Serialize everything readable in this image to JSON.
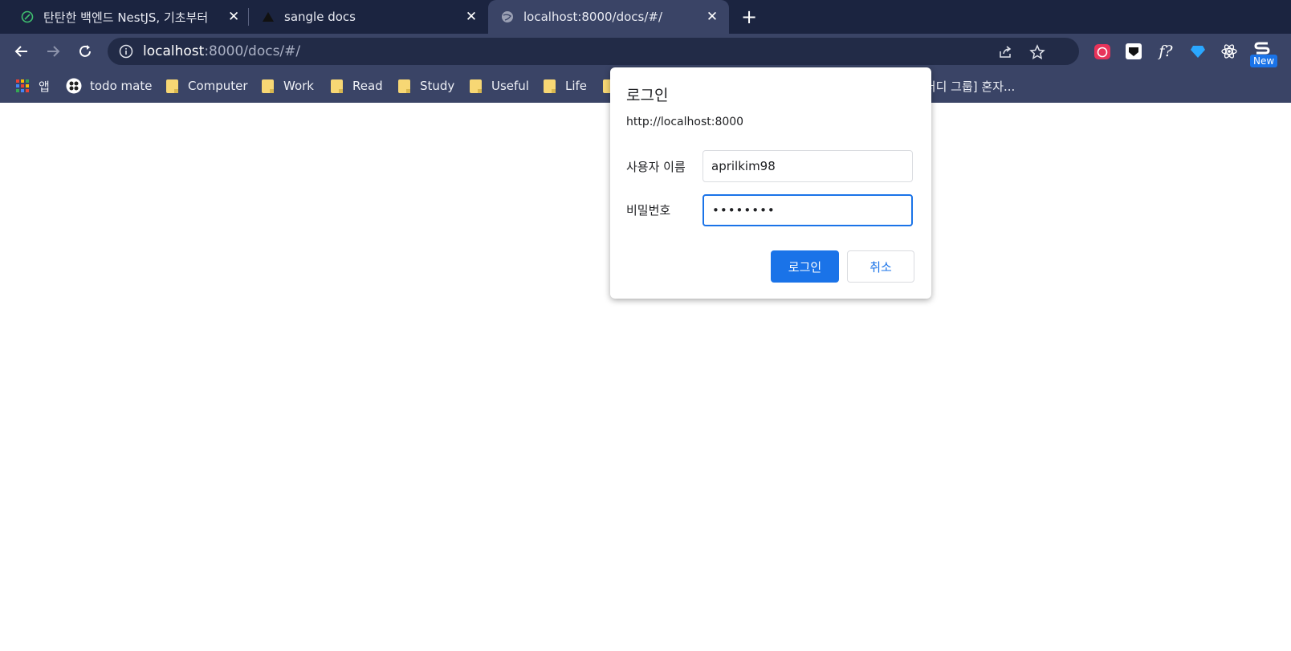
{
  "colors": {
    "tabbar_bg": "#1b2440",
    "toolbar_bg": "#3a4466",
    "accent": "#1a73e8"
  },
  "tabs": [
    {
      "title": "탄탄한 백엔드 NestJS, 기초부터",
      "favicon": "nestjs-leaf-icon",
      "active": false
    },
    {
      "title": "sangle docs",
      "favicon": "triangle-icon",
      "active": false
    },
    {
      "title": "localhost:8000/docs/#/",
      "favicon": "globe-icon",
      "active": true
    }
  ],
  "omnibox": {
    "host": "localhost",
    "path": ":8000/docs/#/"
  },
  "extensions": {
    "new_badge": "New"
  },
  "bookmarks": [
    {
      "label": "앱",
      "icon": "apps-grid-icon"
    },
    {
      "label": "todo mate",
      "icon": "todo-mate-icon"
    },
    {
      "label": "Computer",
      "icon": "folder-icon"
    },
    {
      "label": "Work",
      "icon": "folder-icon"
    },
    {
      "label": "Read",
      "icon": "folder-icon"
    },
    {
      "label": "Study",
      "icon": "folder-icon"
    },
    {
      "label": "Useful",
      "icon": "folder-icon"
    },
    {
      "label": "Life",
      "icon": "folder-icon"
    },
    {
      "label": "스터디 그룹] 혼자...",
      "icon": "folder-icon"
    }
  ],
  "dialog": {
    "title": "로그인",
    "origin": "http://localhost:8000",
    "username_label": "사용자 이름",
    "username_value": "aprilkim98",
    "password_label": "비밀번호",
    "password_value": "••••••••",
    "login_button": "로그인",
    "cancel_button": "취소"
  }
}
